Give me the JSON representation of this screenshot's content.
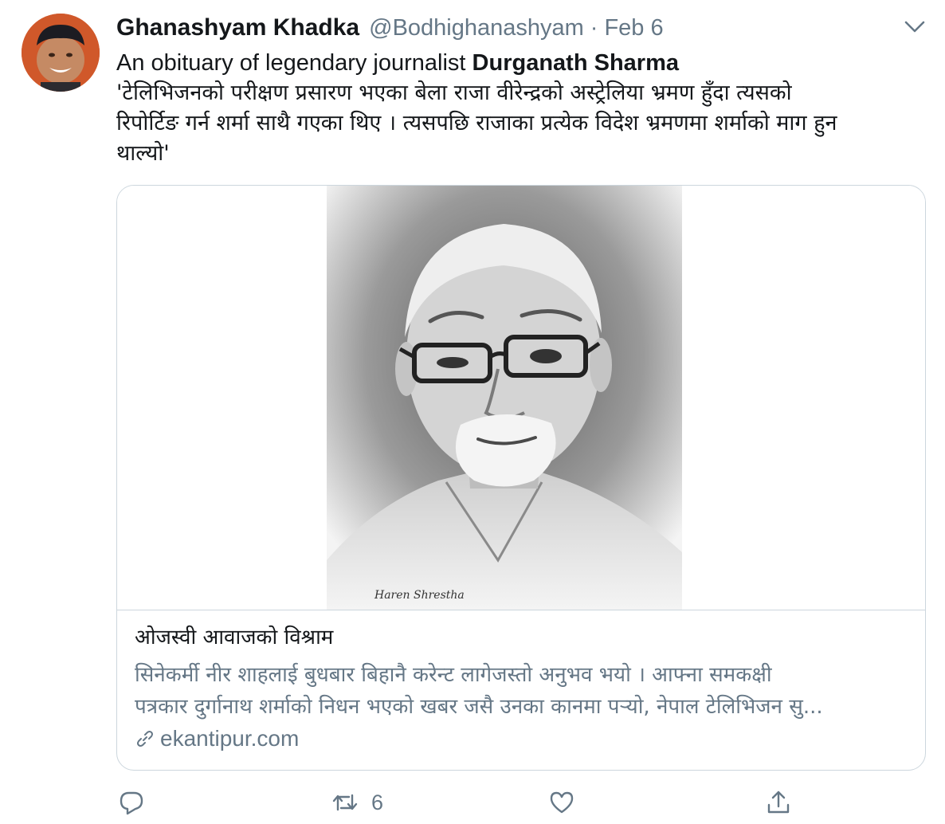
{
  "tweet": {
    "author": {
      "display_name": "Ghanashyam Khadka",
      "handle": "@Bodhighanashyam"
    },
    "separator": "·",
    "date": "Feb 6",
    "text": {
      "intro": "An obituary of legendary journalist ",
      "intro_bold": "Durganath Sharma",
      "quote_lines": [
        "'टेलिभिजनको परीक्षण प्रसारण भएका बेला राजा वीरेन्द्रको अस्ट्रेलिया भ्रमण हुँदा त्यसको",
        "रिपोर्टिङ गर्न शर्मा साथै गएका थिए । त्यसपछि राजाका प्रत्येक विदेश भ्रमणमा शर्माको माग हुन",
        "थाल्यो'"
      ]
    },
    "card": {
      "title": "ओजस्वी आवाजको विश्राम",
      "description_lines": [
        "सिनेकर्मी नीर शाहलाई बुधबार बिहानै करेन्ट लागेजस्तो अनुभव भयो । आफ्ना समकक्षी",
        "पत्रकार दुर्गानाथ शर्माको निधन भएको खबर जसै उनका कानमा पर्‍यो, नेपाल टेलिभिजन सु..."
      ],
      "domain": "ekantipur.com",
      "image_signature": "Haren Shrestha"
    },
    "actions": {
      "reply_count": "",
      "retweet_count": "6",
      "like_count": ""
    },
    "icons": {
      "menu": "chevron-down-icon",
      "link": "link-icon",
      "reply": "reply-icon",
      "retweet": "retweet-icon",
      "like": "heart-icon",
      "share": "share-icon"
    },
    "colors": {
      "text": "#14171a",
      "secondary": "#657786",
      "border": "#ccd6dd",
      "avatar_bg": "#d85a2a"
    }
  }
}
